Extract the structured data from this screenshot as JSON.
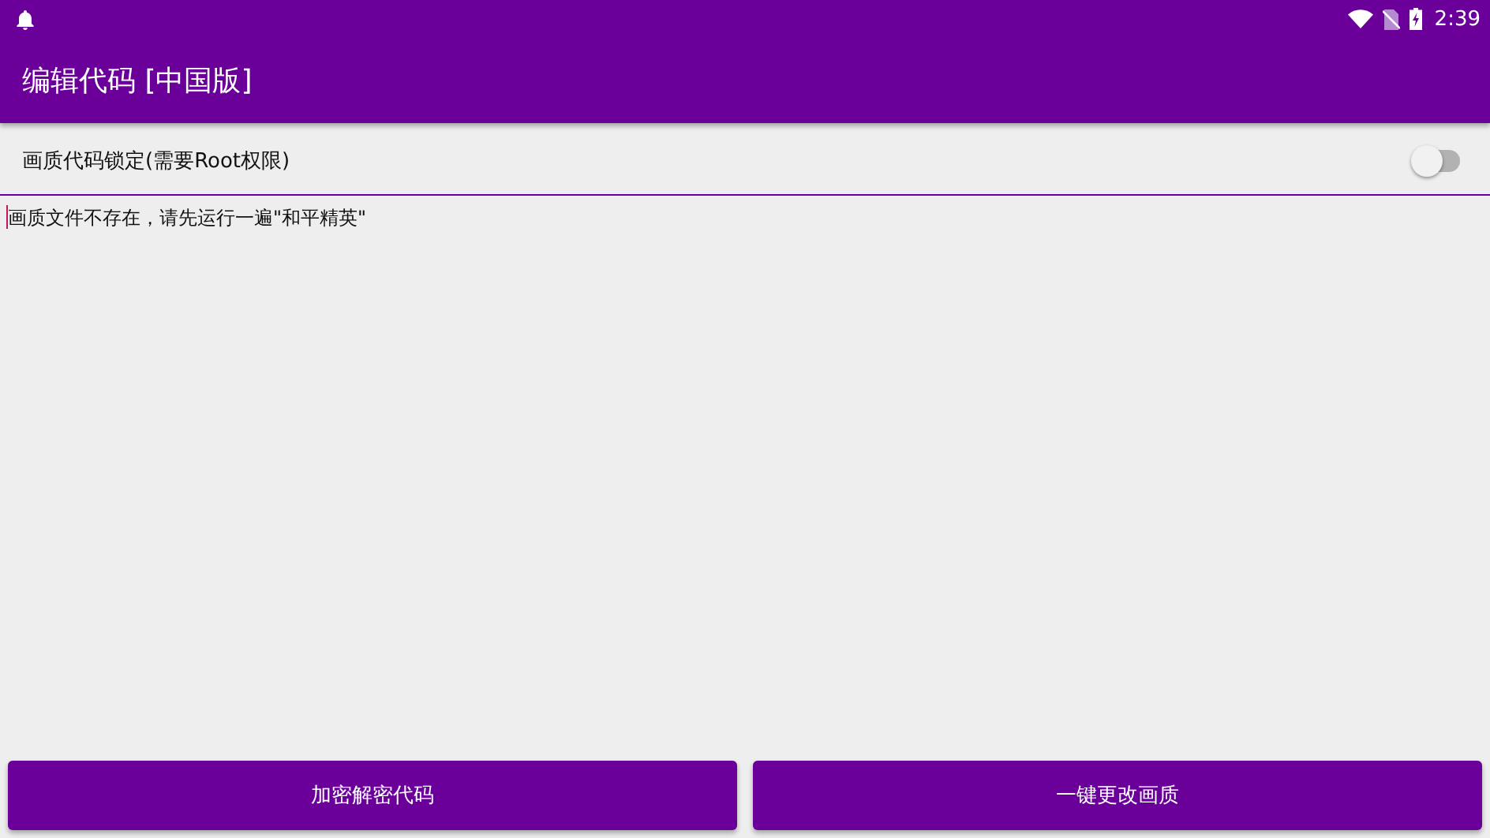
{
  "status_bar": {
    "time": "2:39"
  },
  "toolbar": {
    "title": "编辑代码 [中国版]"
  },
  "lock_switch": {
    "label": "画质代码锁定(需要Root权限)",
    "on": false
  },
  "editor": {
    "value": "画质文件不存在，请先运行一遍\"和平精英\""
  },
  "buttons": [
    {
      "label": "加密解密代码"
    },
    {
      "label": "一键更改画质"
    }
  ]
}
